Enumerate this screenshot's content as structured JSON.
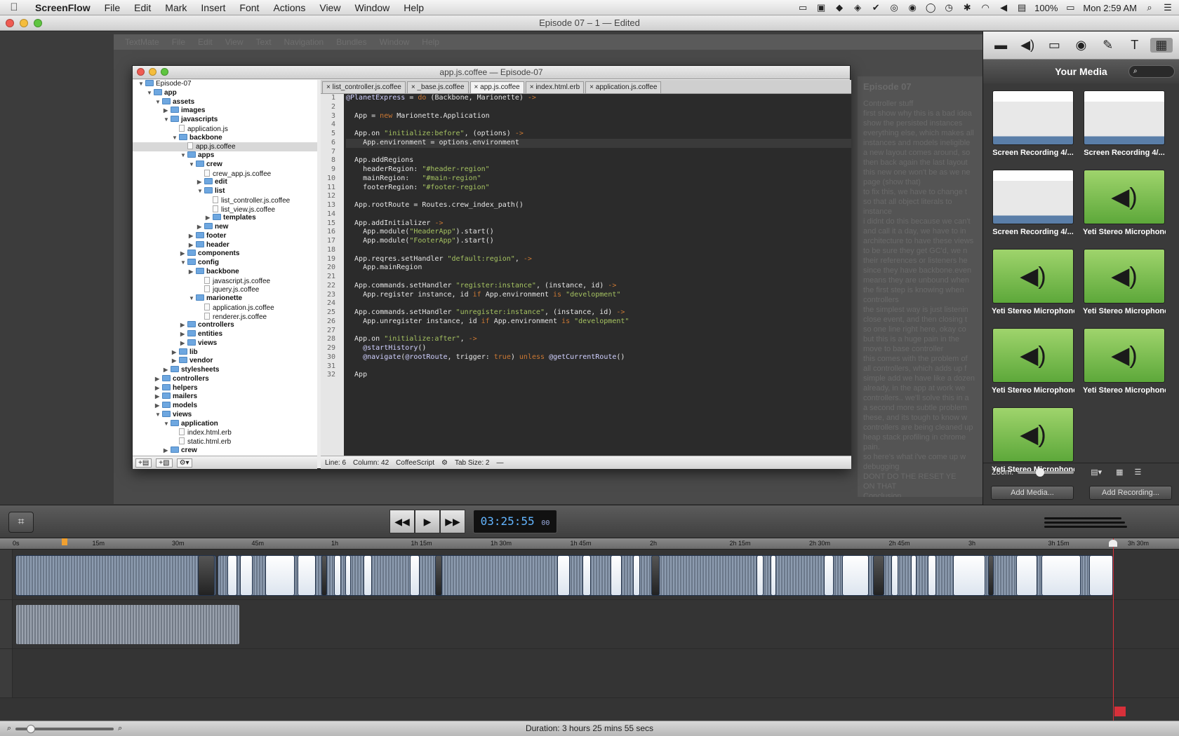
{
  "menubar": {
    "app": "ScreenFlow",
    "items": [
      "File",
      "Edit",
      "Mark",
      "Insert",
      "Font",
      "Actions",
      "View",
      "Window",
      "Help"
    ],
    "battery": "100%",
    "clock": "Mon 2:59 AM"
  },
  "window": {
    "title": "Episode 07 – 1 — Edited"
  },
  "recording": {
    "menu_items": [
      "TextMate",
      "File",
      "Edit",
      "View",
      "Text",
      "Navigation",
      "Bundles",
      "Window",
      "Help"
    ],
    "notes_title": "Episode 07",
    "notes_lines": [
      "Controller stuff",
      "first show why this is a bad idea",
      "show the persisted instances",
      "everything else, which makes all",
      "instances and models ineligible",
      "a new layout comes around, so",
      "then back again the last layout",
      "this new one won't be as we ne",
      "page (show that)",
      "to fix this, we have to change t",
      "so that all object literals to instance",
      "i didnt do this because we can't",
      "and call it a day, we have to in",
      "architecture to have these views",
      "to be sure they get GC'd, we n",
      "their references or listeners he",
      "since they have backbone.even",
      "means they are unbound when",
      "the first step is knowing when",
      "controllers",
      "the simplest way is just listenin",
      "close event, and then closing t",
      "so one line right here, okay co",
      "but this is a huge pain in the",
      "move to base controller",
      "this comes with the problem of",
      "all controllers, which adds up f",
      "simple add we have like a dozen",
      "already, in the app at work we",
      "controllers.. we'll solve this in a",
      "a second more subtle problem",
      "these, and its tough to know w",
      "controllers are being cleaned up",
      "heap stack profiling in chrome",
      "pain.",
      "so here's what i've come up w",
      "debugging",
      "DONT DO THE RESET YE",
      "ON THAT",
      "Conclusion",
      "you might have noticed that we",
      "over the place in this episode"
    ]
  },
  "textmate": {
    "title": "app.js.coffee — Episode-07",
    "tree": [
      {
        "label": "Episode-07",
        "depth": 0,
        "type": "folder",
        "open": true
      },
      {
        "label": "app",
        "depth": 1,
        "type": "folder",
        "open": true,
        "bold": true
      },
      {
        "label": "assets",
        "depth": 2,
        "type": "folder",
        "open": true,
        "bold": true
      },
      {
        "label": "images",
        "depth": 3,
        "type": "folder",
        "open": false,
        "bold": true
      },
      {
        "label": "javascripts",
        "depth": 3,
        "type": "folder",
        "open": true,
        "bold": true
      },
      {
        "label": "application.js",
        "depth": 4,
        "type": "file"
      },
      {
        "label": "backbone",
        "depth": 4,
        "type": "folder",
        "open": true,
        "bold": true
      },
      {
        "label": "app.js.coffee",
        "depth": 5,
        "type": "file",
        "selected": true
      },
      {
        "label": "apps",
        "depth": 5,
        "type": "folder",
        "open": true,
        "bold": true
      },
      {
        "label": "crew",
        "depth": 6,
        "type": "folder",
        "open": true,
        "bold": true
      },
      {
        "label": "crew_app.js.coffee",
        "depth": 7,
        "type": "file"
      },
      {
        "label": "edit",
        "depth": 7,
        "type": "folder",
        "open": false,
        "bold": true
      },
      {
        "label": "list",
        "depth": 7,
        "type": "folder",
        "open": true,
        "bold": true
      },
      {
        "label": "list_controller.js.coffee",
        "depth": 8,
        "type": "file"
      },
      {
        "label": "list_view.js.coffee",
        "depth": 8,
        "type": "file"
      },
      {
        "label": "templates",
        "depth": 8,
        "type": "folder",
        "open": false,
        "bold": true
      },
      {
        "label": "new",
        "depth": 7,
        "type": "folder",
        "open": false,
        "bold": true
      },
      {
        "label": "footer",
        "depth": 6,
        "type": "folder",
        "open": false,
        "bold": true
      },
      {
        "label": "header",
        "depth": 6,
        "type": "folder",
        "open": false,
        "bold": true
      },
      {
        "label": "components",
        "depth": 5,
        "type": "folder",
        "open": false,
        "bold": true
      },
      {
        "label": "config",
        "depth": 5,
        "type": "folder",
        "open": true,
        "bold": true
      },
      {
        "label": "backbone",
        "depth": 6,
        "type": "folder",
        "open": false,
        "bold": true
      },
      {
        "label": "javascript.js.coffee",
        "depth": 7,
        "type": "file"
      },
      {
        "label": "jquery.js.coffee",
        "depth": 7,
        "type": "file"
      },
      {
        "label": "marionette",
        "depth": 6,
        "type": "folder",
        "open": true,
        "bold": true
      },
      {
        "label": "application.js.coffee",
        "depth": 7,
        "type": "file"
      },
      {
        "label": "renderer.js.coffee",
        "depth": 7,
        "type": "file"
      },
      {
        "label": "controllers",
        "depth": 5,
        "type": "folder",
        "open": false,
        "bold": true
      },
      {
        "label": "entities",
        "depth": 5,
        "type": "folder",
        "open": false,
        "bold": true
      },
      {
        "label": "views",
        "depth": 5,
        "type": "folder",
        "open": false,
        "bold": true
      },
      {
        "label": "lib",
        "depth": 4,
        "type": "folder",
        "open": false,
        "bold": true
      },
      {
        "label": "vendor",
        "depth": 4,
        "type": "folder",
        "open": false,
        "bold": true
      },
      {
        "label": "stylesheets",
        "depth": 3,
        "type": "folder",
        "open": false,
        "bold": true
      },
      {
        "label": "controllers",
        "depth": 2,
        "type": "folder",
        "open": false,
        "bold": true
      },
      {
        "label": "helpers",
        "depth": 2,
        "type": "folder",
        "open": false,
        "bold": true
      },
      {
        "label": "mailers",
        "depth": 2,
        "type": "folder",
        "open": false,
        "bold": true
      },
      {
        "label": "models",
        "depth": 2,
        "type": "folder",
        "open": false,
        "bold": true
      },
      {
        "label": "views",
        "depth": 2,
        "type": "folder",
        "open": true,
        "bold": true
      },
      {
        "label": "application",
        "depth": 3,
        "type": "folder",
        "open": true,
        "bold": true
      },
      {
        "label": "index.html.erb",
        "depth": 4,
        "type": "file"
      },
      {
        "label": "static.html.erb",
        "depth": 4,
        "type": "file"
      },
      {
        "label": "crew",
        "depth": 3,
        "type": "folder",
        "open": false,
        "bold": true
      }
    ],
    "tabs": [
      {
        "label": "list_controller.js.coffee",
        "active": false
      },
      {
        "label": "_base.js.coffee",
        "active": false
      },
      {
        "label": "app.js.coffee",
        "active": true
      },
      {
        "label": "index.html.erb",
        "active": false
      },
      {
        "label": "application.js.coffee",
        "active": false
      }
    ],
    "code_lines": [
      "@PlanetExpress = do (Backbone, Marionette) ->",
      "",
      "  App = new Marionette.Application",
      "",
      "  App.on \"initialize:before\", (options) ->",
      "    App.environment = options.environment",
      "",
      "  App.addRegions",
      "    headerRegion: \"#header-region\"",
      "    mainRegion:   \"#main-region\"",
      "    footerRegion: \"#footer-region\"",
      "",
      "  App.rootRoute = Routes.crew_index_path()",
      "",
      "  App.addInitializer ->",
      "    App.module(\"HeaderApp\").start()",
      "    App.module(\"FooterApp\").start()",
      "",
      "  App.reqres.setHandler \"default:region\", ->",
      "    App.mainRegion",
      "",
      "  App.commands.setHandler \"register:instance\", (instance, id) ->",
      "    App.register instance, id if App.environment is \"development\"",
      "",
      "  App.commands.setHandler \"unregister:instance\", (instance, id) ->",
      "    App.unregister instance, id if App.environment is \"development\"",
      "",
      "  App.on \"initialize:after\", ->",
      "    @startHistory()",
      "    @navigate(@rootRoute, trigger: true) unless @getCurrentRoute()",
      "",
      "  App"
    ],
    "status": {
      "line": "Line: 6",
      "column": "Column: 42",
      "language": "CoffeeScript",
      "tab_size": "Tab Size:  2",
      "symbol": "—"
    }
  },
  "media_panel": {
    "title": "Your Media",
    "items": [
      {
        "label": "Screen Recording 4/...",
        "kind": "screen"
      },
      {
        "label": "Screen Recording 4/...",
        "kind": "screen"
      },
      {
        "label": "Screen Recording 4/...",
        "kind": "screen"
      },
      {
        "label": "Yeti Stereo Microphone",
        "kind": "audio"
      },
      {
        "label": "Yeti Stereo Microphone",
        "kind": "audio"
      },
      {
        "label": "Yeti Stereo Microphone",
        "kind": "audio"
      },
      {
        "label": "Yeti Stereo Microphone",
        "kind": "audio"
      },
      {
        "label": "Yeti Stereo Microphone",
        "kind": "audio"
      },
      {
        "label": "Yeti Stereo Microphone",
        "kind": "audio"
      }
    ],
    "zoom_label": "Zoom:",
    "add_media": "Add Media...",
    "add_recording": "Add Recording..."
  },
  "transport": {
    "timecode": "03:25:55",
    "frames": "00"
  },
  "timeline": {
    "ruler_labels": [
      "0s",
      "15m",
      "30m",
      "45m",
      "1h",
      "1h 15m",
      "1h 30m",
      "1h 45m",
      "2h",
      "2h 15m",
      "2h 30m",
      "2h 45m",
      "3h",
      "3h 15m",
      "3h 30m"
    ]
  },
  "footer": {
    "duration": "Duration: 3 hours 25 mins 55 secs"
  },
  "colors": {
    "accent": "#63b5ff",
    "playhead": "#d8303a",
    "mic_green": "#7ec453"
  }
}
